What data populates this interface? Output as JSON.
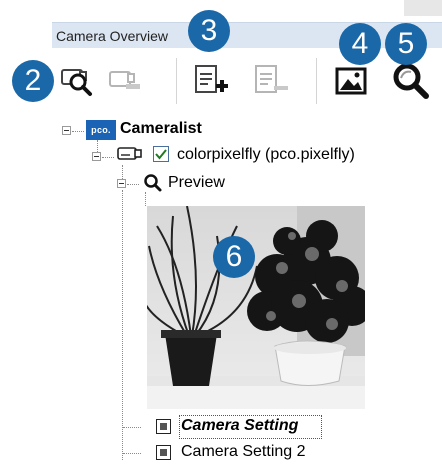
{
  "window": {
    "title": "Camera Overview"
  },
  "badges": [
    "2",
    "3",
    "4",
    "5",
    "6"
  ],
  "toolbar": {
    "buttons": [
      {
        "name": "find-camera",
        "enabled": true
      },
      {
        "name": "remove-camera",
        "enabled": false
      },
      {
        "name": "add-setting",
        "enabled": true
      },
      {
        "name": "remove-setting",
        "enabled": false
      },
      {
        "name": "open-image",
        "enabled": true
      },
      {
        "name": "preview",
        "enabled": true
      }
    ]
  },
  "tree": {
    "root_label": "Cameralist",
    "logo_text": "pco.",
    "camera_label": "colorpixelfly (pco.pixelfly)",
    "camera_checked": true,
    "preview_label": "Preview",
    "setting_selected_label": "Camera Setting",
    "setting2_label": "Camera Setting 2"
  },
  "colors": {
    "badge": "#1a68a8",
    "titlebar": "#dce6f2",
    "logo": "#1b64b5",
    "checkmark": "#1f7a1f"
  }
}
